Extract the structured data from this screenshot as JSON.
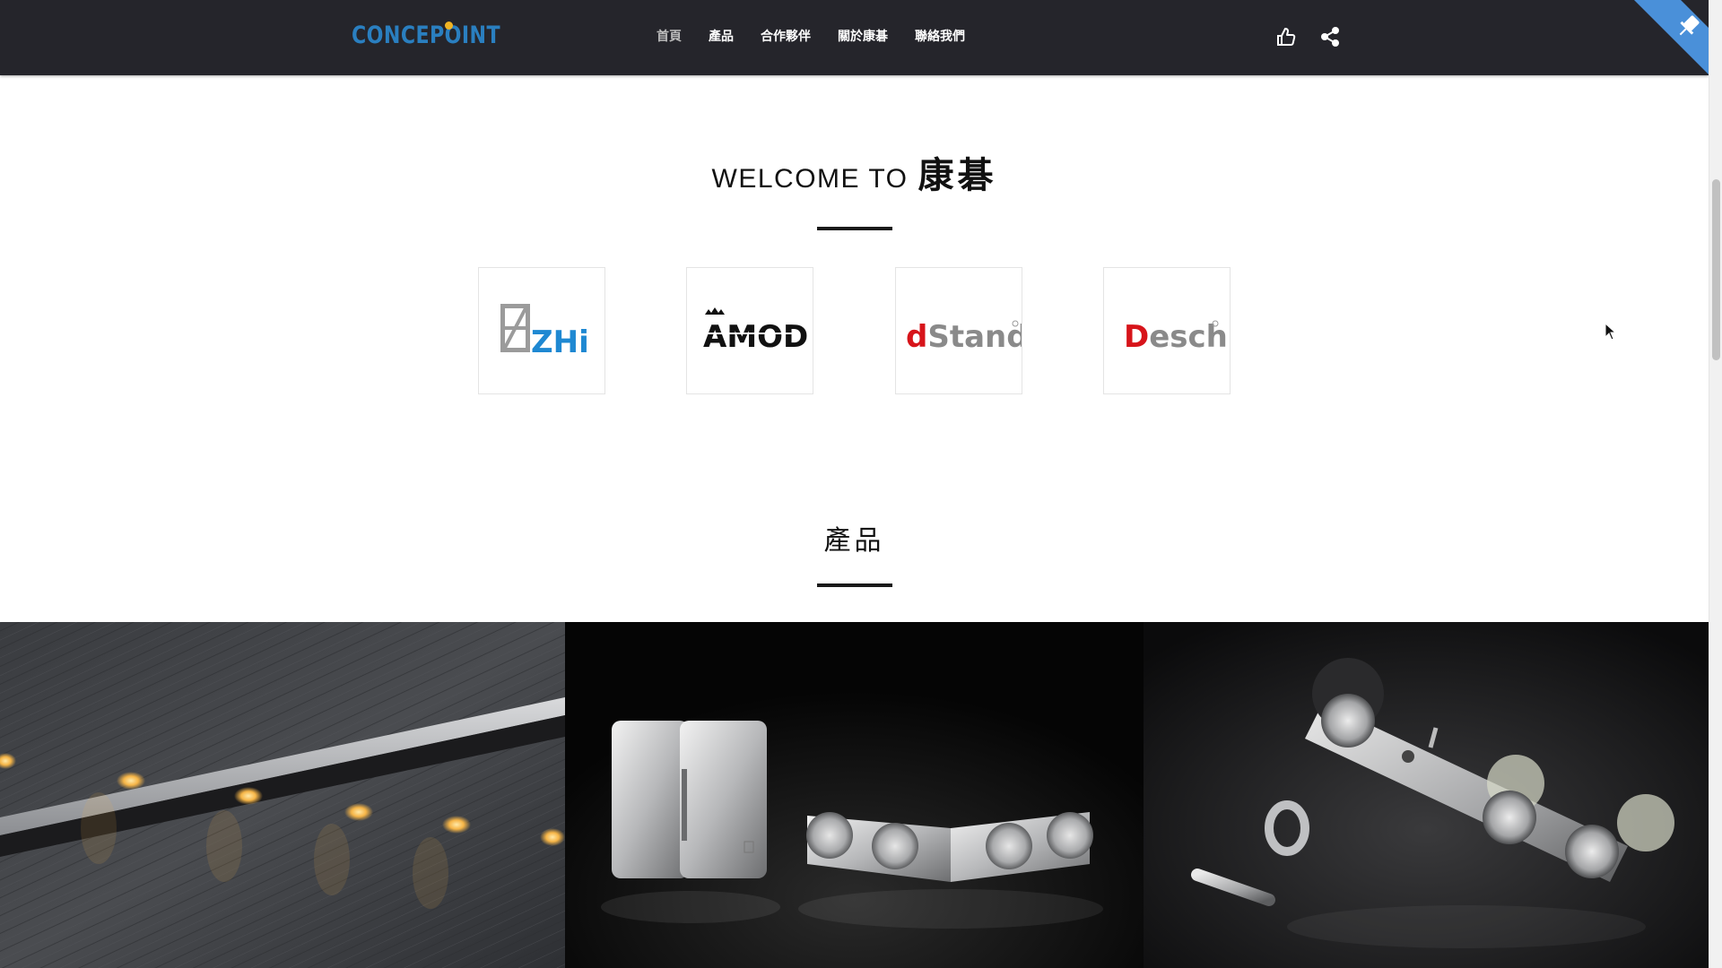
{
  "header": {
    "logo_text": "CONCEPOINT",
    "nav": [
      {
        "label": "首頁",
        "active": true
      },
      {
        "label": "產品",
        "active": false
      },
      {
        "label": "合作夥伴",
        "active": false
      },
      {
        "label": "關於康碁",
        "active": false
      },
      {
        "label": "聯絡我們",
        "active": false
      }
    ],
    "icons": [
      "thumbs-up-icon",
      "share-icon"
    ]
  },
  "welcome": {
    "prefix": "WELCOME TO",
    "brand": "康碁"
  },
  "partners": [
    {
      "name": "ZHi"
    },
    {
      "name": "AMOD"
    },
    {
      "name": "dStand"
    },
    {
      "name": "Desch"
    }
  ],
  "products": {
    "title": "產品"
  },
  "colors": {
    "header_bg": "#25252b",
    "logo_blue": "#2a7fc0",
    "logo_dot": "#f0b323",
    "ribbon_blue": "#4a90d9",
    "brand_red": "#d7141a",
    "zhi_blue": "#1e88d2"
  }
}
